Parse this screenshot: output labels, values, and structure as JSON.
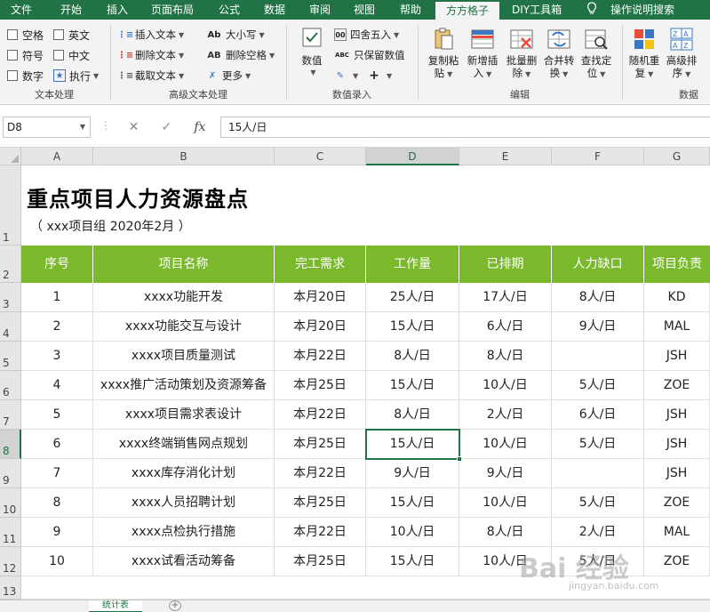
{
  "ribbon_tabs": [
    "文件",
    "开始",
    "插入",
    "页面布局",
    "公式",
    "数据",
    "审阅",
    "视图",
    "帮助",
    "方方格子",
    "DIY工具箱",
    "操作说明搜索"
  ],
  "active_tab": "方方格子",
  "text_group": {
    "label": "文本处理",
    "checkboxes": [
      "空格",
      "英文",
      "符号",
      "中文",
      "数字"
    ],
    "execute": "执行"
  },
  "adv_text_group": {
    "label": "高级文本处理",
    "insert_text": "插入文本",
    "delete_text": "删除文本",
    "extract_text": "截取文本",
    "case": "大小写",
    "case_icon": "Ab",
    "delete_space": "删除空格",
    "delete_space_icon": "AB",
    "more": "更多"
  },
  "num_group": {
    "label": "数值录入",
    "value": "数值",
    "round": "四舍五入",
    "keep_value": "只保留数值",
    "keep_value_icon": "ABC"
  },
  "edit_group": {
    "label": "编辑",
    "copy_paste": [
      "复制粘",
      "贴"
    ],
    "add_insert": [
      "新增插",
      "入"
    ],
    "batch_delete": [
      "批量删",
      "除"
    ],
    "merge_convert": [
      "合并转",
      "换"
    ],
    "find_locate": [
      "查找定",
      "位"
    ]
  },
  "data_group": {
    "label": "数据",
    "random_repeat": [
      "随机重",
      "复"
    ],
    "advanced_sort": [
      "高级排",
      "序"
    ]
  },
  "formula_bar": {
    "name_box": "D8",
    "formula": "15人/日",
    "cancel_icon": "✕",
    "confirm_icon": "✓",
    "fx_label": "fx"
  },
  "columns": [
    "A",
    "B",
    "C",
    "D",
    "E",
    "F",
    "G"
  ],
  "selected_column": "D",
  "row_numbers": [
    "1",
    "2",
    "3",
    "4",
    "5",
    "6",
    "7",
    "8",
    "9",
    "10",
    "11",
    "12",
    "13"
  ],
  "selected_row": "8",
  "sheet": {
    "title": "重点项目人力资源盘点",
    "subtitle": "（ xxx项目组 2020年2月 ）",
    "headers": [
      "序号",
      "项目名称",
      "完工需求",
      "工作量",
      "已排期",
      "人力缺口",
      "项目负责"
    ],
    "rows": [
      [
        "1",
        "xxxx功能开发",
        "本月20日",
        "25人/日",
        "17人/日",
        "8人/日",
        "KD"
      ],
      [
        "2",
        "xxxx功能交互与设计",
        "本月20日",
        "15人/日",
        "6人/日",
        "9人/日",
        "MAL"
      ],
      [
        "3",
        "xxxx项目质量测试",
        "本月22日",
        "8人/日",
        "8人/日",
        "",
        "JSH"
      ],
      [
        "4",
        "xxxx推广活动策划及资源筹备",
        "本月25日",
        "15人/日",
        "10人/日",
        "5人/日",
        "ZOE"
      ],
      [
        "5",
        "xxxx项目需求表设计",
        "本月22日",
        "8人/日",
        "2人/日",
        "6人/日",
        "JSH"
      ],
      [
        "6",
        "xxxx终端销售网点规划",
        "本月25日",
        "15人/日",
        "10人/日",
        "5人/日",
        "JSH"
      ],
      [
        "7",
        "xxxx库存消化计划",
        "本月22日",
        "9人/日",
        "9人/日",
        "",
        "JSH"
      ],
      [
        "8",
        "xxxx人员招聘计划",
        "本月25日",
        "15人/日",
        "10人/日",
        "5人/日",
        "ZOE"
      ],
      [
        "9",
        "xxxx点检执行措施",
        "本月22日",
        "10人/日",
        "8人/日",
        "2人/日",
        "MAL"
      ],
      [
        "10",
        "xxxx试看活动筹备",
        "本月25日",
        "15人/日",
        "10人/日",
        "5人/日",
        "ZOE"
      ]
    ]
  },
  "sheet_tab": "统计表",
  "watermark": "Bai 经验",
  "watermark_sub": "jingyan.baidu.com",
  "colors": {
    "ribbon_green": "#217346",
    "header_green": "#7ab82c"
  }
}
